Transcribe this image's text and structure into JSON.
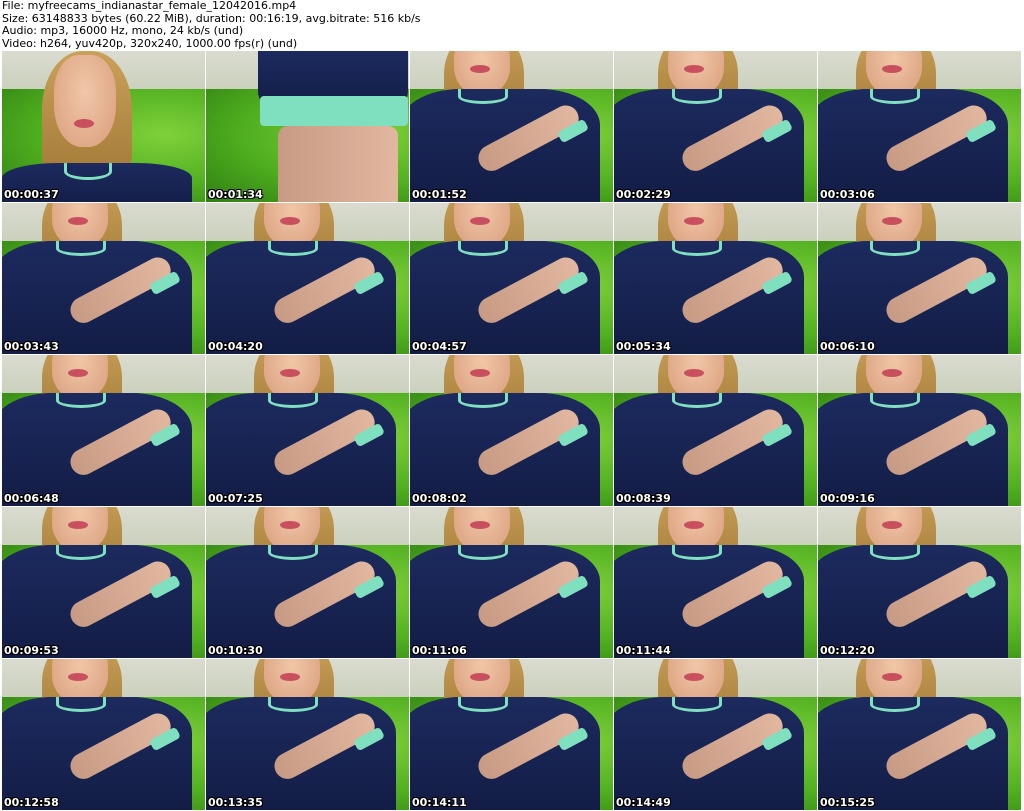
{
  "header": {
    "file_line": "File: myfreecams_indianastar_female_12042016.mp4",
    "size_line": "Size: 63148833 bytes (60.22 MiB), duration: 00:16:19, avg.bitrate: 516 kb/s",
    "audio_line": "Audio: mp3, 16000 Hz, mono, 24 kb/s (und)",
    "video_line": "Video: h264, yuv420p, 320x240, 1000.00 fps(r) (und)"
  },
  "thumbnails": [
    {
      "timestamp": "00:00:37",
      "scene": "closeup"
    },
    {
      "timestamp": "00:01:34",
      "scene": "sleeve"
    },
    {
      "timestamp": "00:01:52",
      "scene": "seated"
    },
    {
      "timestamp": "00:02:29",
      "scene": "seated"
    },
    {
      "timestamp": "00:03:06",
      "scene": "seated"
    },
    {
      "timestamp": "00:03:43",
      "scene": "seated"
    },
    {
      "timestamp": "00:04:20",
      "scene": "seated"
    },
    {
      "timestamp": "00:04:57",
      "scene": "seated"
    },
    {
      "timestamp": "00:05:34",
      "scene": "seated"
    },
    {
      "timestamp": "00:06:10",
      "scene": "seated"
    },
    {
      "timestamp": "00:06:48",
      "scene": "seated"
    },
    {
      "timestamp": "00:07:25",
      "scene": "seated"
    },
    {
      "timestamp": "00:08:02",
      "scene": "seated"
    },
    {
      "timestamp": "00:08:39",
      "scene": "seated"
    },
    {
      "timestamp": "00:09:16",
      "scene": "seated"
    },
    {
      "timestamp": "00:09:53",
      "scene": "seated"
    },
    {
      "timestamp": "00:10:30",
      "scene": "seated"
    },
    {
      "timestamp": "00:11:06",
      "scene": "seated"
    },
    {
      "timestamp": "00:11:44",
      "scene": "seated"
    },
    {
      "timestamp": "00:12:20",
      "scene": "seated"
    },
    {
      "timestamp": "00:12:58",
      "scene": "seated"
    },
    {
      "timestamp": "00:13:35",
      "scene": "seated"
    },
    {
      "timestamp": "00:14:11",
      "scene": "seated"
    },
    {
      "timestamp": "00:14:49",
      "scene": "seated"
    },
    {
      "timestamp": "00:15:25",
      "scene": "seated"
    }
  ]
}
